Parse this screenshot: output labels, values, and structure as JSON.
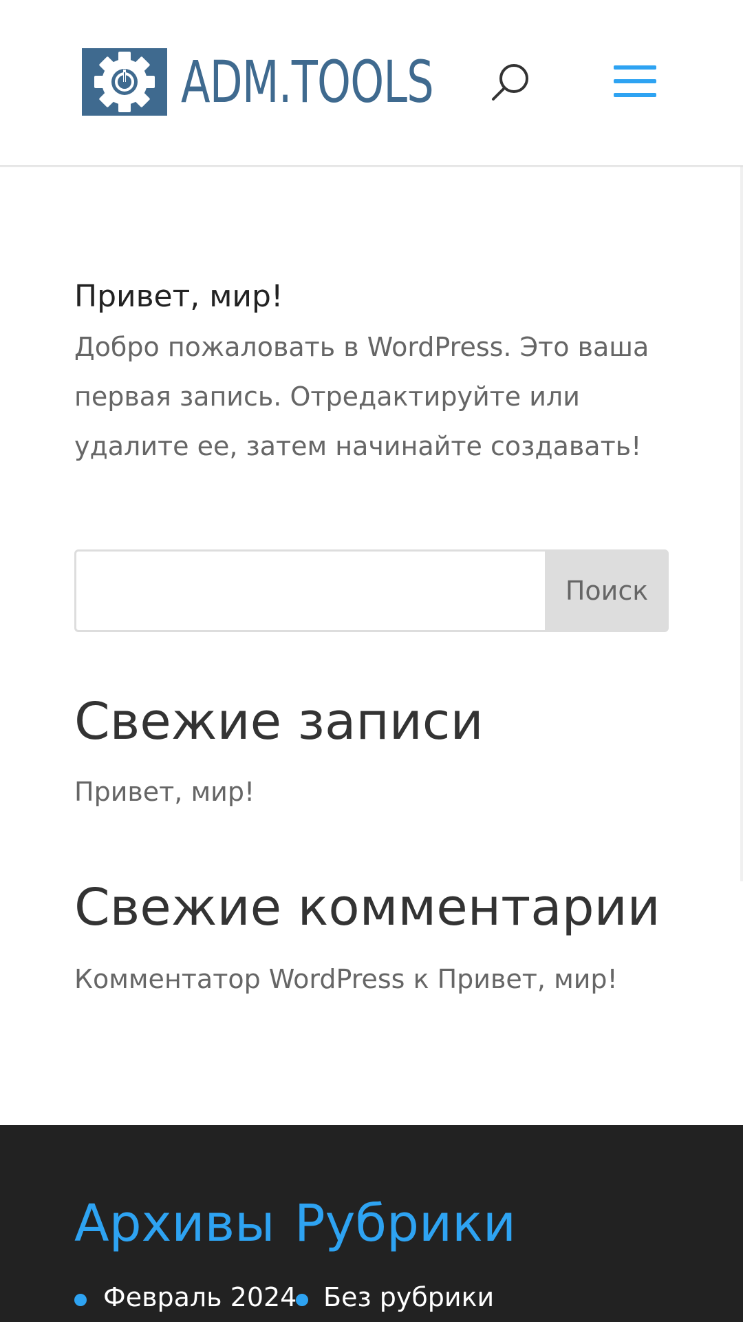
{
  "header": {
    "logo_text": "ADM.TOOLS",
    "logo_icon": "gear-power-icon",
    "search_icon": "search-icon",
    "menu_icon": "hamburger-menu-icon"
  },
  "post": {
    "title": "Привет, мир!",
    "excerpt": "Добро пожаловать в WordPress. Это ваша первая запись. Отредактируйте или удалите ее, затем начинайте создавать!"
  },
  "search": {
    "placeholder": "",
    "value": "",
    "button_label": "Поиск"
  },
  "recent_posts": {
    "title": "Свежие записи",
    "items": [
      "Привет, мир!"
    ]
  },
  "recent_comments": {
    "title": "Свежие комментарии",
    "author": "Комментатор WordPress",
    "connector": " к ",
    "post": "Привет, мир!"
  },
  "footer": {
    "archives": {
      "title": "Архивы",
      "items": [
        "Февраль 2024"
      ]
    },
    "categories": {
      "title": "Рубрики",
      "items": [
        "Без рубрики"
      ]
    }
  },
  "colors": {
    "accent": "#2ea3f2",
    "logo": "#3f6a8f",
    "footer_bg": "#222222"
  }
}
